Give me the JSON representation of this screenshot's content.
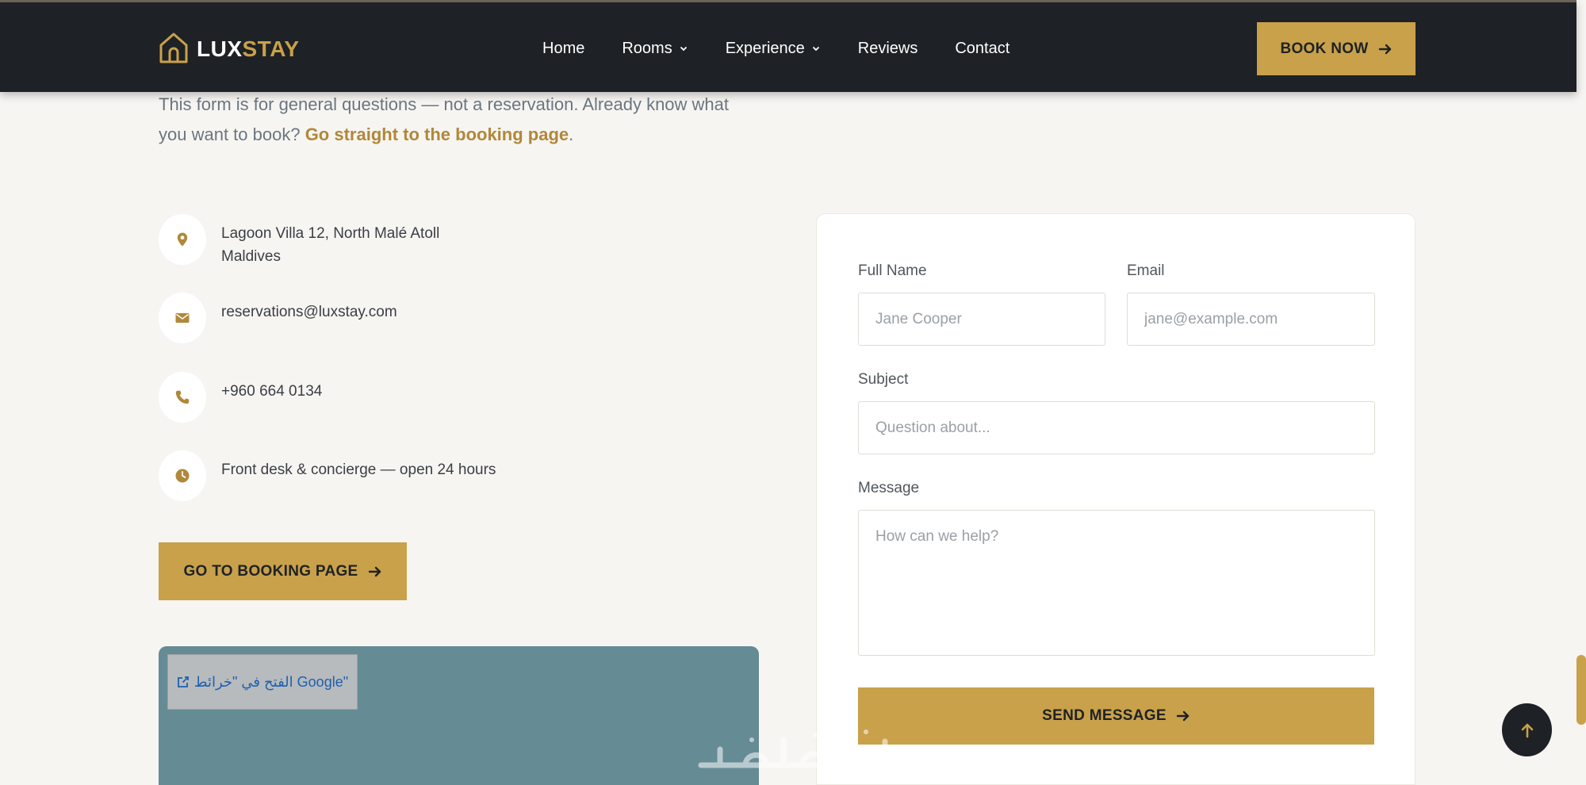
{
  "header": {
    "logo_part1": "LUX",
    "logo_part2": "STAY",
    "nav": [
      {
        "label": "Home"
      },
      {
        "label": "Rooms"
      },
      {
        "label": "Experience"
      },
      {
        "label": "Reviews"
      },
      {
        "label": "Contact"
      }
    ],
    "book_now_label": "BOOK NOW"
  },
  "intro": {
    "text": "This form is for general questions — not a reservation. Already know what you want to book? ",
    "link_text": "Go straight to the booking page",
    "suffix": "."
  },
  "contact_info": {
    "address_line1": "Lagoon Villa 12, North Malé Atoll",
    "address_line2": "Maldives",
    "email": "reservations@luxstay.com",
    "phone": "+960 664 0134",
    "hours": "Front desk & concierge — open 24 hours"
  },
  "goto_booking_label": "GO TO BOOKING PAGE",
  "map": {
    "open_label": "الفتح في \"خرائط Google\""
  },
  "form": {
    "full_name_label": "Full Name",
    "full_name_placeholder": "Jane Cooper",
    "email_label": "Email",
    "email_placeholder": "jane@example.com",
    "subject_label": "Subject",
    "subject_placeholder": "Question about...",
    "message_label": "Message",
    "message_placeholder": "How can we help?",
    "send_label": "SEND MESSAGE"
  },
  "icons": {
    "logo": "house-icon",
    "address": "map-pin-icon",
    "email": "envelope-icon",
    "phone": "phone-icon",
    "hours": "clock-icon",
    "arrow": "arrow-right-icon",
    "external": "external-link-icon",
    "to_top": "arrow-up-icon"
  },
  "colors": {
    "accent": "#c9a14a",
    "header_bg": "#1e2226",
    "page_bg": "#f7f5f2",
    "link": "#b0883a",
    "map": "#658b94"
  }
}
